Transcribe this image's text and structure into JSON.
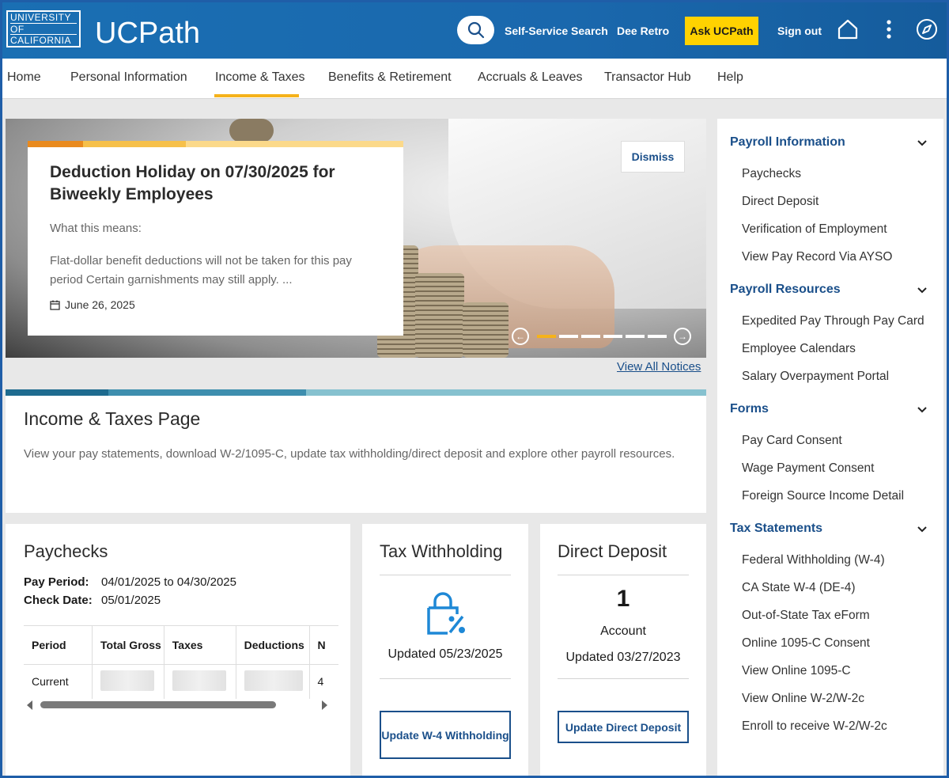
{
  "header": {
    "logo_lines": [
      "UNIVERSITY",
      "OF",
      "CALIFORNIA"
    ],
    "app_title": "UCPath",
    "self_service_search": "Self-Service Search",
    "user_name": "Dee Retro",
    "ask_ucpath": "Ask UCPath",
    "sign_out": "Sign out",
    "icons": [
      "search-icon",
      "home-icon",
      "more-vertical-icon",
      "compass-icon"
    ]
  },
  "nav": {
    "items": [
      "Home",
      "Personal Information",
      "Income & Taxes",
      "Benefits & Retirement",
      "Accruals & Leaves",
      "Transactor Hub",
      "Help"
    ],
    "active": "Income & Taxes",
    "accent_color": "#f5b21b"
  },
  "notice": {
    "title": "Deduction Holiday on 07/30/2025 for Biweekly Employees",
    "subtitle": "What this means:",
    "body": "Flat-dollar benefit deductions will not be taken for this pay period Certain garnishments may still apply. ...",
    "date": "June 26, 2025",
    "dismiss": "Dismiss",
    "view_all": "View All Notices",
    "carousel_total": 6,
    "carousel_active": 1
  },
  "income": {
    "title": "Income & Taxes Page",
    "description": "View your pay statements, download W-2/1095-C, update tax withholding/direct deposit and explore other payroll resources."
  },
  "paychecks": {
    "title": "Paychecks",
    "pay_period_label": "Pay Period:",
    "pay_period_value": "04/01/2025 to 04/30/2025",
    "check_date_label": "Check Date:",
    "check_date_value": "05/01/2025",
    "columns": [
      "Period",
      "Total Gross",
      "Taxes",
      "Deductions",
      "N"
    ],
    "rows": [
      {
        "period": "Current",
        "last": "4"
      }
    ]
  },
  "tax_withholding": {
    "title": "Tax Withholding",
    "updated": "Updated 05/23/2025",
    "button": "Update W-4 Withholding"
  },
  "direct_deposit": {
    "title": "Direct Deposit",
    "count": "1",
    "count_label": "Account",
    "updated": "Updated 03/27/2023",
    "button": "Update Direct Deposit"
  },
  "sidebar": {
    "sections": [
      {
        "title": "Payroll Information",
        "items": [
          "Paychecks",
          "Direct Deposit",
          "Verification of Employment",
          "View Pay Record Via AYSO"
        ]
      },
      {
        "title": "Payroll Resources",
        "items": [
          "Expedited Pay Through Pay Card",
          "Employee Calendars",
          "Salary Overpayment Portal"
        ]
      },
      {
        "title": "Forms",
        "items": [
          "Pay Card Consent",
          "Wage Payment Consent",
          "Foreign Source Income Detail"
        ]
      },
      {
        "title": "Tax Statements",
        "items": [
          "Federal Withholding (W-4)",
          "CA State W-4 (DE-4)",
          "Out-of-State Tax eForm",
          "Online 1095-C Consent",
          "View Online 1095-C",
          "View Online W-2/W-2c",
          "Enroll to receive W-2/W-2c"
        ]
      }
    ]
  },
  "colors": {
    "brand_blue": "#1a6fb3",
    "link_blue": "#1a4f8a",
    "ask_yellow": "#ffd200",
    "icon_blue": "#1e88d6"
  }
}
